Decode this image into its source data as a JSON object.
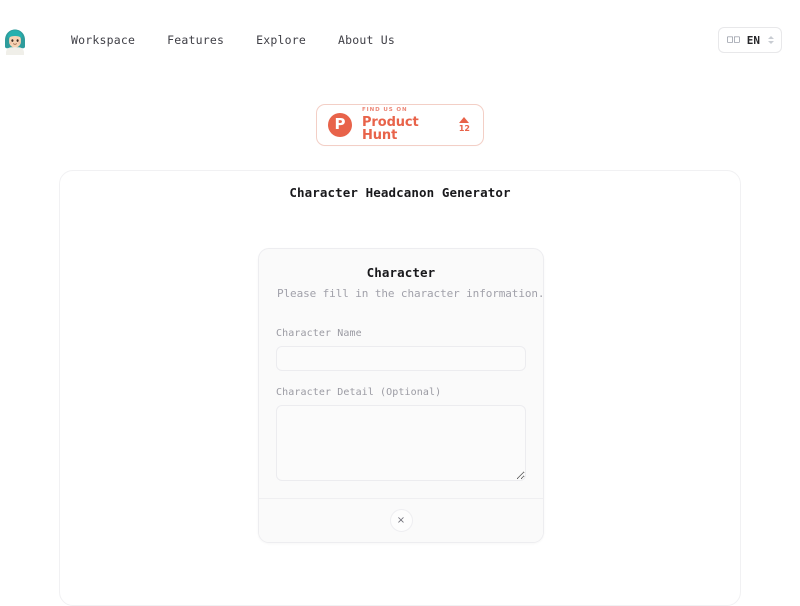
{
  "header": {
    "brand": {
      "icon": "avatar-icon",
      "alt": "User avatar logo"
    },
    "nav": [
      {
        "label": "Workspace"
      },
      {
        "label": "Features"
      },
      {
        "label": "Explore"
      },
      {
        "label": "About Us"
      }
    ],
    "language_selector": {
      "globe_glyph": "□□",
      "code": "EN",
      "caret_icon": "chevron-updown-icon"
    }
  },
  "product_hunt": {
    "logo_letter": "P",
    "pretext": "FIND US ON",
    "name": "Product Hunt",
    "upvote_icon": "triangle-up-icon",
    "upvote_count": "12",
    "accent_color": "#e8634a",
    "border_color": "#f3cfc6"
  },
  "panel": {
    "title": "Character Headcanon Generator"
  },
  "modal": {
    "title": "Character",
    "subtitle": "Please fill in the character information.",
    "fields": [
      {
        "label": "Character Name",
        "value": "",
        "placeholder": ""
      },
      {
        "label": "Character Detail (Optional)",
        "value": "",
        "placeholder": ""
      }
    ],
    "footer": {
      "close_icon": "close-x-icon",
      "close_label": "×"
    }
  }
}
